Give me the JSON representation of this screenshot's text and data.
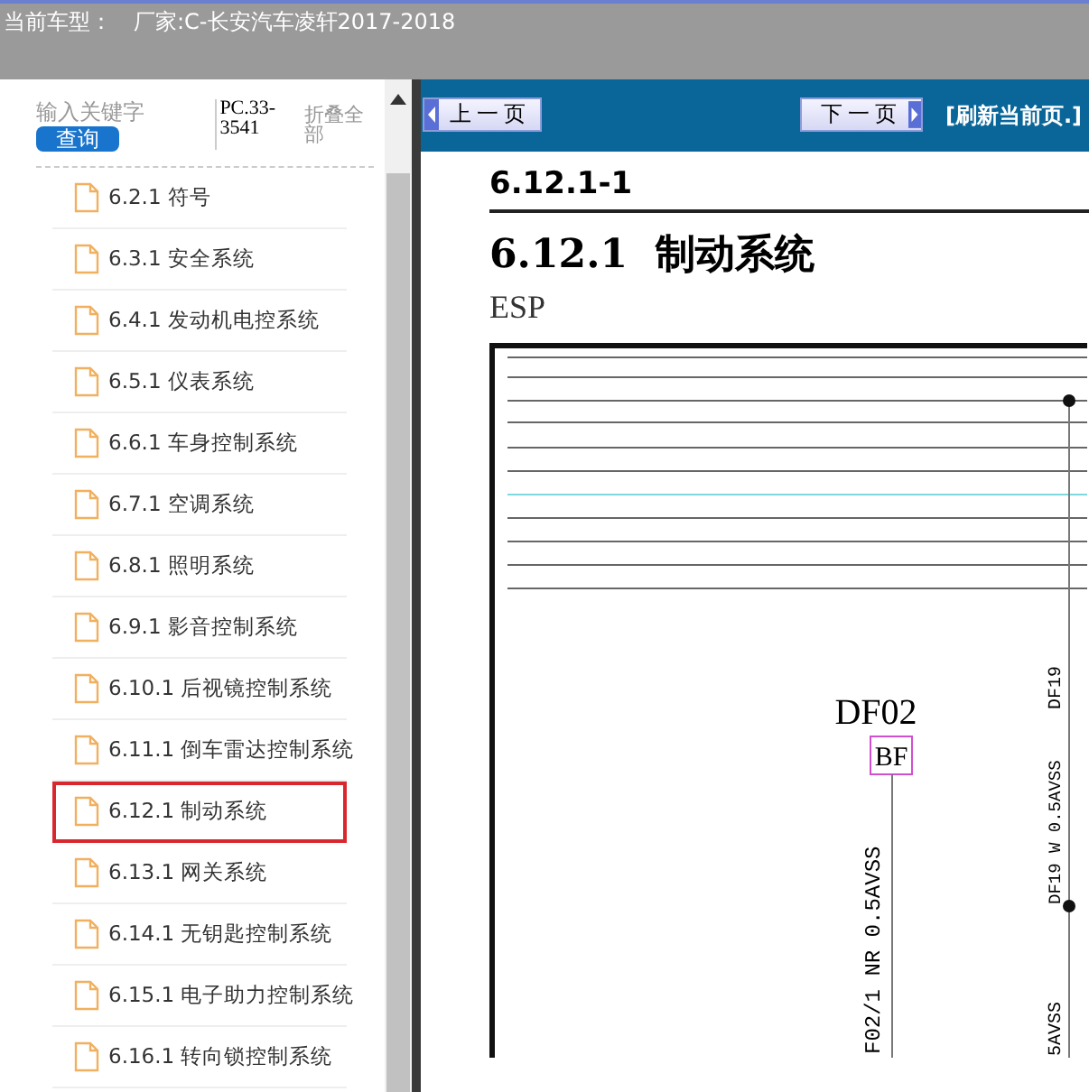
{
  "header": {
    "label": "当前车型：",
    "value": "厂家:C-长安汽车凌轩2017-2018"
  },
  "sidebar": {
    "search": {
      "placeholder": "输入关键字",
      "button": "查询"
    },
    "code": "PC.33-3541",
    "collapse_link": "折叠全部",
    "items": [
      {
        "label": "6.2.1 符号",
        "selected": false
      },
      {
        "label": "6.3.1 安全系统",
        "selected": false
      },
      {
        "label": "6.4.1 发动机电控系统",
        "selected": false
      },
      {
        "label": "6.5.1 仪表系统",
        "selected": false
      },
      {
        "label": "6.6.1 车身控制系统",
        "selected": false
      },
      {
        "label": "6.7.1 空调系统",
        "selected": false
      },
      {
        "label": "6.8.1 照明系统",
        "selected": false
      },
      {
        "label": "6.9.1 影音控制系统",
        "selected": false
      },
      {
        "label": "6.10.1 后视镜控制系统",
        "selected": false
      },
      {
        "label": "6.11.1 倒车雷达控制系统",
        "selected": false
      },
      {
        "label": "6.12.1 制动系统",
        "selected": true
      },
      {
        "label": "6.13.1 网关系统",
        "selected": false
      },
      {
        "label": "6.14.1 无钥匙控制系统",
        "selected": false
      },
      {
        "label": "6.15.1 电子助力控制系统",
        "selected": false
      },
      {
        "label": "6.16.1 转向锁控制系统",
        "selected": false
      }
    ]
  },
  "toolbar": {
    "prev": "上一页",
    "next": "下一页",
    "refresh": "[刷新当前页.]"
  },
  "document": {
    "page_number": "6.12.1-1",
    "title_number": "6.12.1",
    "title": "制动系统",
    "subtitle": "ESP",
    "diagram": {
      "connector": "DF02",
      "pin": "BF",
      "wire_left": "F02/1 NR 0.5AVSS",
      "wire_right_top": "DF19",
      "wire_right": "DF19 W 0.5AVSS",
      "wire_right_bottom": "5AVSS"
    }
  }
}
